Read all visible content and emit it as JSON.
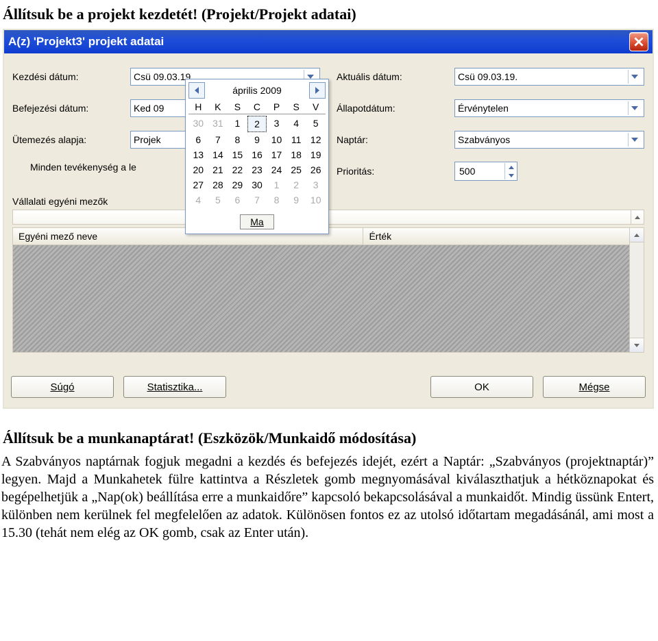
{
  "doc": {
    "heading1": "Állítsuk be a projekt kezdetét! (Projekt/Projekt adatai)",
    "heading2": "Állítsuk be a munkanaptárat! (Eszközök/Munkaidő módosítása)",
    "paragraph": "A Szabványos naptárnak fogjuk megadni a kezdés és befejezés idejét, ezért a Naptár: „Szabványos (projektnaptár)” legyen. Majd a Munkahetek fülre kattintva a Részletek gomb megnyomásával kiválaszthatjuk a hétköznapokat és begépelhetjük a „Nap(ok) beállítása erre a munkaidőre” kapcsoló bekapcsolásával a munkaidőt. Mindig üssünk Entert, különben nem kerülnek fel megfelelően az adatok. Különösen fontos ez az utolsó időtartam megadásánál, ami most a 15.30 (tehát nem elég az OK gomb, csak az Enter után)."
  },
  "dialog": {
    "title": "A(z) 'Projekt3' projekt adatai",
    "labels": {
      "startDate": "Kezdési dátum:",
      "endDate": "Befejezési dátum:",
      "scheduleBase": "Ütemezés alapja:",
      "allTasksNote": "Minden tevékenység a le",
      "customFields": "Vállalati egyéni mezők",
      "currentDate": "Aktuális dátum:",
      "statusDate": "Állapotdátum:",
      "calendar": "Naptár:",
      "priority": "Prioritás:"
    },
    "values": {
      "startDate": "Csü 09.03.19.",
      "endDate": "Ked 09",
      "scheduleBase": "Projek",
      "currentDate": "Csü 09.03.19.",
      "statusDate": "Érvénytelen",
      "calendar": "Szabványos",
      "priority": "500"
    },
    "gridHeaders": {
      "name": "Egyéni mező neve",
      "value": "Érték"
    },
    "buttons": {
      "help": "Súgó",
      "stats": "Statisztika...",
      "ok": "OK",
      "cancel": "Mégse"
    }
  },
  "datepicker": {
    "month": "április 2009",
    "dayHeaders": [
      "H",
      "K",
      "S",
      "C",
      "P",
      "S",
      "V"
    ],
    "weeks": [
      [
        {
          "d": "30",
          "out": true
        },
        {
          "d": "31",
          "out": true
        },
        {
          "d": "1"
        },
        {
          "d": "2",
          "sel": true
        },
        {
          "d": "3"
        },
        {
          "d": "4"
        },
        {
          "d": "5"
        }
      ],
      [
        {
          "d": "6"
        },
        {
          "d": "7"
        },
        {
          "d": "8"
        },
        {
          "d": "9"
        },
        {
          "d": "10"
        },
        {
          "d": "11"
        },
        {
          "d": "12"
        }
      ],
      [
        {
          "d": "13"
        },
        {
          "d": "14"
        },
        {
          "d": "15"
        },
        {
          "d": "16"
        },
        {
          "d": "17"
        },
        {
          "d": "18"
        },
        {
          "d": "19"
        }
      ],
      [
        {
          "d": "20"
        },
        {
          "d": "21"
        },
        {
          "d": "22"
        },
        {
          "d": "23"
        },
        {
          "d": "24"
        },
        {
          "d": "25"
        },
        {
          "d": "26"
        }
      ],
      [
        {
          "d": "27"
        },
        {
          "d": "28"
        },
        {
          "d": "29"
        },
        {
          "d": "30"
        },
        {
          "d": "1",
          "out": true
        },
        {
          "d": "2",
          "out": true
        },
        {
          "d": "3",
          "out": true
        }
      ],
      [
        {
          "d": "4",
          "out": true
        },
        {
          "d": "5",
          "out": true
        },
        {
          "d": "6",
          "out": true
        },
        {
          "d": "7",
          "out": true
        },
        {
          "d": "8",
          "out": true
        },
        {
          "d": "9",
          "out": true
        },
        {
          "d": "10",
          "out": true
        }
      ]
    ],
    "today": "Ma"
  }
}
